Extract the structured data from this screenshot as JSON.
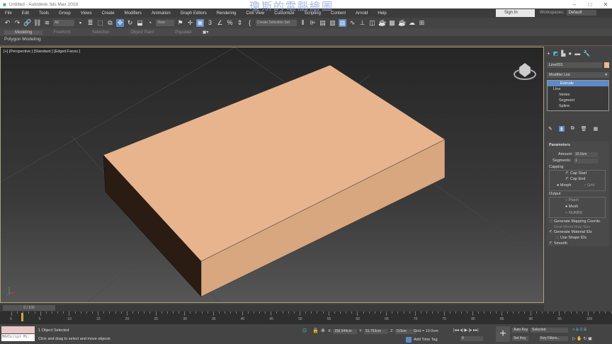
{
  "window": {
    "title": "Untitled - Autodesk 3ds Max 2018",
    "watermark": "瓊斯的電腦繪圖",
    "min": "–",
    "max": "□",
    "close": "✕"
  },
  "menu": [
    "File",
    "Edit",
    "Tools",
    "Group",
    "Views",
    "Create",
    "Modifiers",
    "Animation",
    "Graph Editors",
    "Rendering",
    "Civil View",
    "Customize",
    "Scripting",
    "Content",
    "Arnold",
    "Help"
  ],
  "account": {
    "sign_in": "Sign In",
    "workspaces_label": "Workspaces:",
    "workspace": "Default"
  },
  "toolbar": {
    "selection_filter": "All",
    "ref_coord": "View",
    "named_selection": "Create Selection Set"
  },
  "ribbon": {
    "tabs": [
      "Modeling",
      "Freeform",
      "Selection",
      "Object Paint",
      "Populate"
    ],
    "active": "Modeling",
    "sub": "Polygon Modeling"
  },
  "viewport": {
    "label": "[+] [Perspective ] [Standard ] [Edged Faces ]",
    "object_color": "#e8b48e"
  },
  "command_panel": {
    "object_name": "Line001",
    "object_color": "#f2b88a",
    "modifier_list": "Modifier List",
    "stack": [
      {
        "label": "Extrude",
        "selected": true
      },
      {
        "label": "Line"
      },
      {
        "label": "Vertex"
      },
      {
        "label": "Segment"
      },
      {
        "label": "Spline"
      }
    ],
    "params": {
      "title": "Parameters",
      "amount_label": "Amount:",
      "amount": "10.0cm",
      "segments_label": "Segments:",
      "segments": "1",
      "capping": "Capping",
      "cap_start": "Cap Start",
      "cap_end": "Cap End",
      "morph": "Morph",
      "grid": "Grid",
      "output": "Output",
      "patch": "Patch",
      "mesh": "Mesh",
      "nurbs": "NURBS",
      "gen_mapping": "Generate Mapping Coords.",
      "real_world": "Real-World Map Size",
      "gen_matids": "Generate Material IDs",
      "use_shape_ids": "Use Shape IDs",
      "smooth": "Smooth"
    }
  },
  "timeline": {
    "frame": "0 / 100",
    "ticks": [
      "0",
      "5",
      "10",
      "15",
      "20",
      "25",
      "30",
      "35",
      "40",
      "45",
      "50",
      "55",
      "60",
      "65",
      "70",
      "75",
      "80",
      "85",
      "90",
      "95",
      "100"
    ]
  },
  "status": {
    "maxscript": "MAXScript Mi:",
    "selected": "1 Object Selected",
    "prompt": "Click and drag to select and move objects",
    "x_label": "X:",
    "x": "156.544cm",
    "y_label": "Y:",
    "y": "51.753cm",
    "z_label": "Z:",
    "z": "0.0cm",
    "grid": "Grid = 10.0cm",
    "add_time_tag": "Add Time Tag",
    "auto_key": "Auto Key",
    "set_key": "Set Key",
    "key_mode": "Selected",
    "key_filters": "Key Filters...",
    "current_frame": "0"
  }
}
